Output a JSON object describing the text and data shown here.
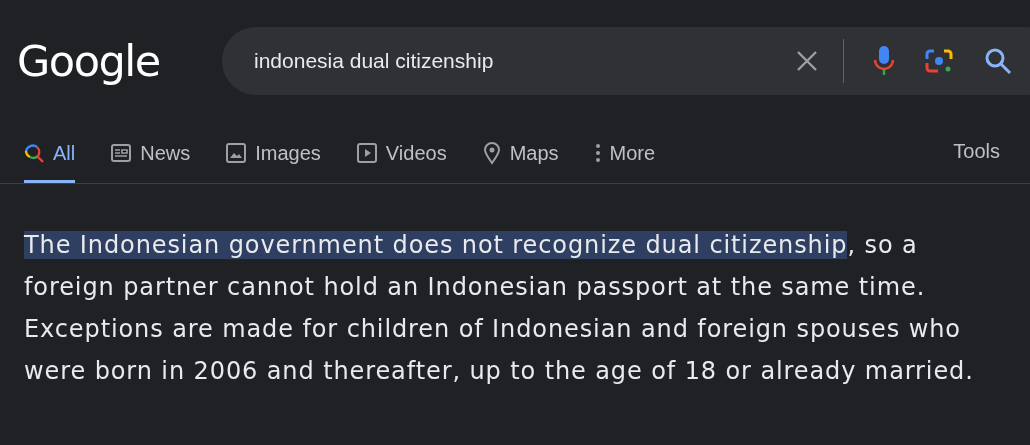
{
  "logo": "Google",
  "search": {
    "value": "indonesia dual citizenship"
  },
  "tabs": [
    {
      "label": "All",
      "kind": "search",
      "selected": true
    },
    {
      "label": "News",
      "kind": "news",
      "selected": false
    },
    {
      "label": "Images",
      "kind": "image",
      "selected": false
    },
    {
      "label": "Videos",
      "kind": "video",
      "selected": false
    },
    {
      "label": "Maps",
      "kind": "pin",
      "selected": false
    },
    {
      "label": "More",
      "kind": "dots",
      "selected": false
    }
  ],
  "tools": "Tools",
  "snippet": {
    "highlighted": "The Indonesian government does not recognize dual citizenship",
    "text": ", so a foreign partner cannot hold an Indonesian passport at the same time. Exceptions are made for children of Indonesian and foreign spouses who were born in 2006 and thereafter, up to the age of 18 or already married."
  }
}
